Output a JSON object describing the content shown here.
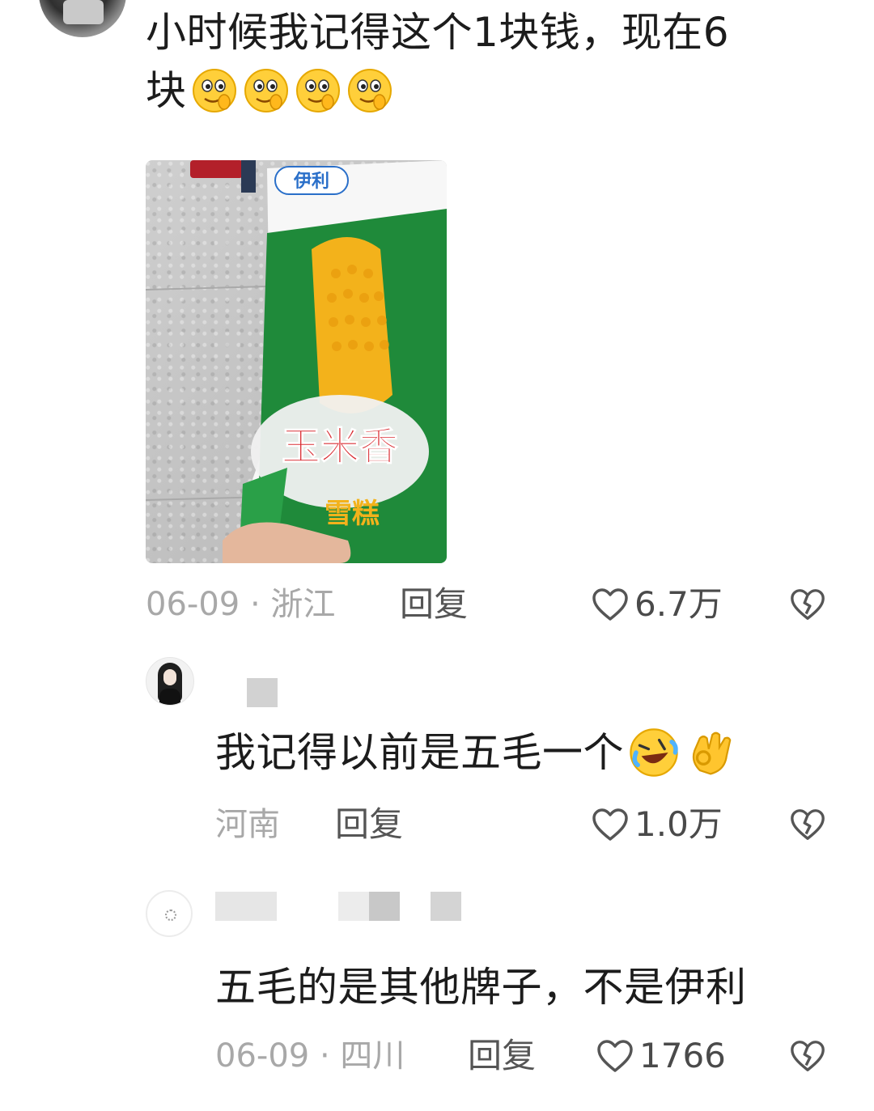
{
  "main_comment": {
    "text_line1": "小时候我记得这个1块钱，现在6",
    "text_line2": "块",
    "emoji_count": 4,
    "photo": {
      "brand_label": "伊利",
      "product_label": "玉米香",
      "sub_label": "雪糕"
    },
    "date": "06-09",
    "region": "浙江",
    "meta_sep": " · ",
    "reply_label": "回复",
    "like_count": "6.7万"
  },
  "replies": [
    {
      "text": "我记得以前是五毛一个",
      "region": "河南",
      "reply_label": "回复",
      "like_count": "1.0万"
    },
    {
      "text": "五毛的是其他牌子，不是伊利",
      "date": "06-09",
      "region": "四川",
      "meta_sep": " · ",
      "reply_label": "回复",
      "like_count": "1766"
    }
  ],
  "icons": {
    "like": "heart-outline-icon",
    "dislike": "broken-heart-icon",
    "emoji_main": "yummy-face-emoji",
    "emoji_reply_1": "rolling-laughing-emoji",
    "emoji_reply_2": "ok-hand-emoji"
  },
  "colors": {
    "meta_gray": "#a8a8a8",
    "text_dark": "#1c1c1c",
    "brand_red": "#d8262c",
    "package_green": "#1f8a3a",
    "corn_yellow": "#f3b21b"
  }
}
